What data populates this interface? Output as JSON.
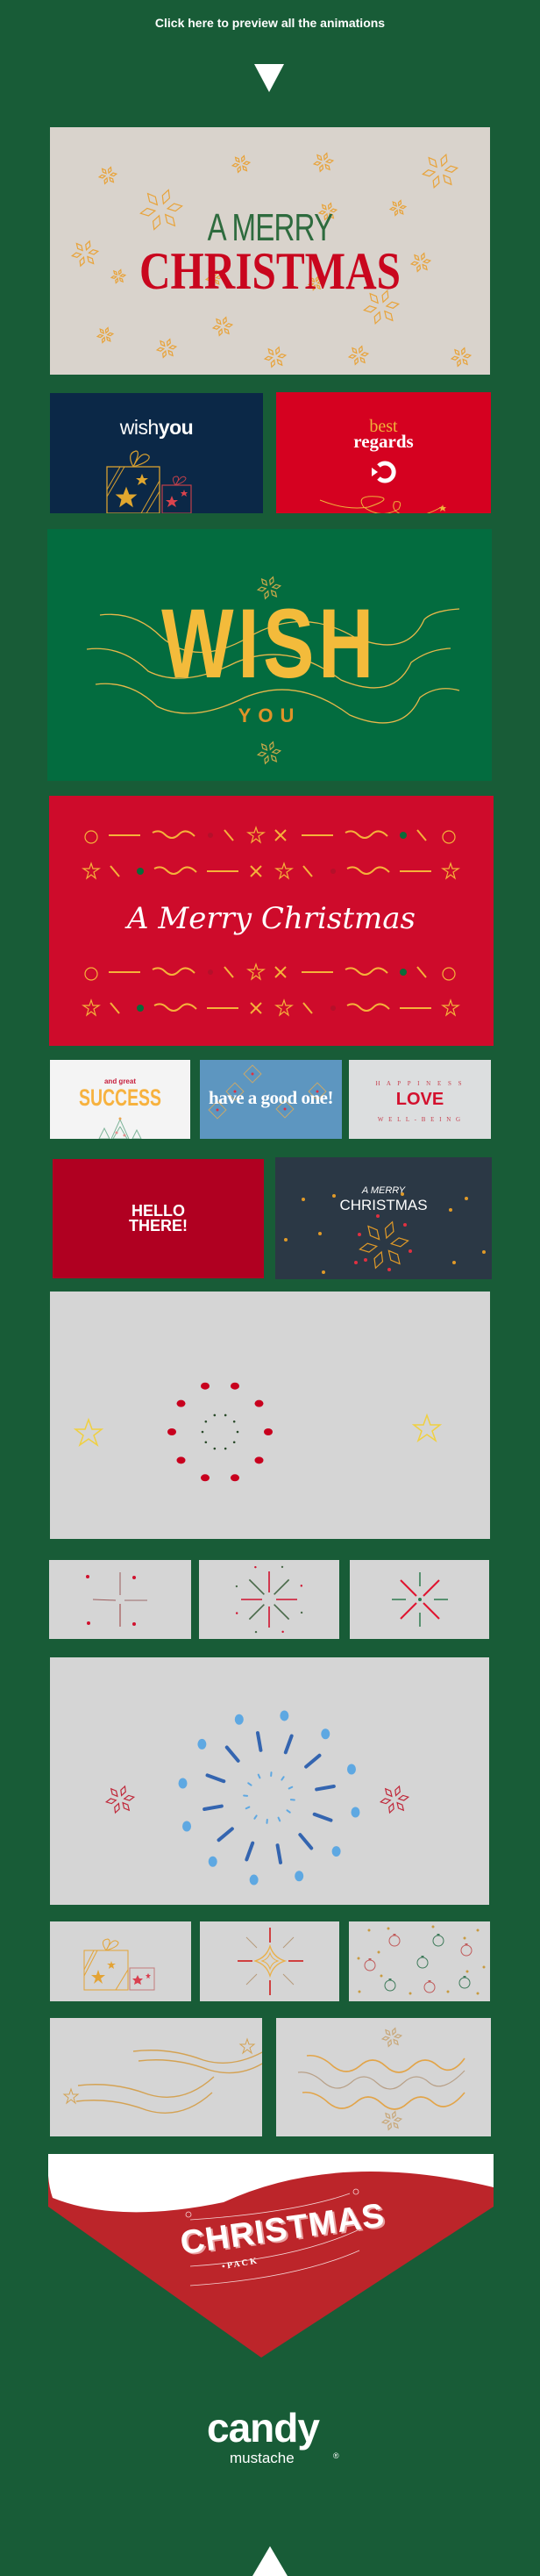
{
  "header": {
    "cta_label": "Click here to preview all the animations",
    "arrow_icon": "triangle-down-icon"
  },
  "colors": {
    "page_bg": "#185c37",
    "red": "#d0062a",
    "gold": "#f0b43a",
    "navy": "#0b2847",
    "green": "#036c3f",
    "beige": "#d9d3cc",
    "grey": "#d5d5d5"
  },
  "cards": {
    "merry_christmas_beige": {
      "line1": "A MERRY",
      "line2": "CHRISTMAS"
    },
    "wish_you_navy": {
      "word1": "wish",
      "word2": "you"
    },
    "best_regards": {
      "line1": "best",
      "line2": "regards"
    },
    "wish_green": {
      "big": "WISH",
      "small": "YOU"
    },
    "script_red": {
      "text": "A Merry Christmas"
    },
    "success": {
      "small": "and great",
      "big": "SUCCESS"
    },
    "good_one": {
      "text": "have a good one!"
    },
    "love": {
      "top": "H A P P I N E S S",
      "mid": "LOVE",
      "bottom": "W E L L - B E I N G"
    },
    "hello": {
      "line1": "HELLO",
      "line2": "THERE!"
    },
    "dark_christmas": {
      "line1": "A MERRY",
      "line2": "CHRISTMAS"
    }
  },
  "banner": {
    "title": "CHRISTMAS",
    "subtitle": "• P A C K"
  },
  "footer": {
    "logo_main": "candy",
    "logo_sub": "mustache",
    "registered": "®",
    "arrow_icon": "triangle-up-icon"
  }
}
